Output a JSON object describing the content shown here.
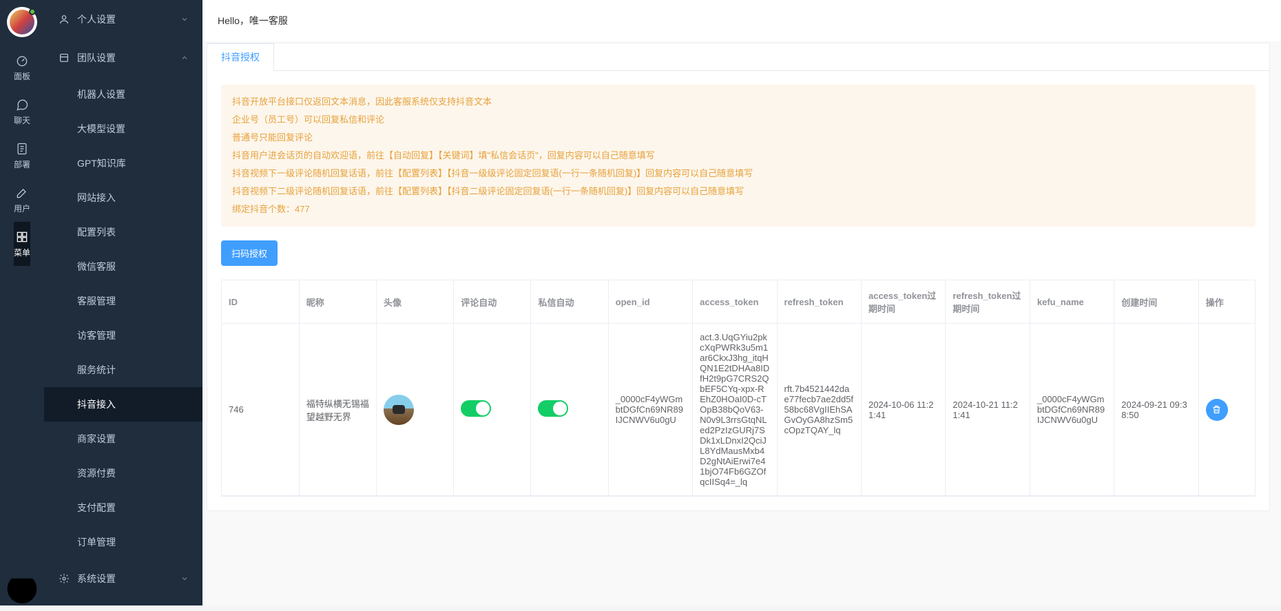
{
  "narrowNav": [
    {
      "label": "面板",
      "icon": "gauge"
    },
    {
      "label": "聊天",
      "icon": "chat"
    },
    {
      "label": "部署",
      "icon": "file"
    },
    {
      "label": "用户",
      "icon": "edit"
    },
    {
      "label": "菜单",
      "icon": "grid"
    }
  ],
  "narrowActive": 4,
  "wideMenu": {
    "personal": {
      "label": "个人设置"
    },
    "team": {
      "label": "团队设置"
    },
    "system": {
      "label": "系统设置"
    },
    "teamItems": [
      "机器人设置",
      "大模型设置",
      "GPT知识库",
      "网站接入",
      "配置列表",
      "微信客服",
      "客服管理",
      "访客管理",
      "服务统计",
      "抖音接入",
      "商家设置",
      "资源付费",
      "支付配置",
      "订单管理"
    ],
    "activeTeamItem": 9
  },
  "header": {
    "greeting": "Hello，唯一客服"
  },
  "tab": {
    "label": "抖音授权"
  },
  "alert": {
    "lines": [
      "抖音开放平台接口仅返回文本消息，因此客服系统仅支持抖音文本",
      "企业号（员工号）可以回复私信和评论",
      "普通号只能回复评论",
      "抖音用户进会话页的自动欢迎语，前往【自动回复】【关键词】填\"私信会话页\"，回复内容可以自己随意填写",
      "抖音视频下一级评论随机回复话语，前往【配置列表】【抖音一级级评论固定回复语(一行一条随机回复)】回复内容可以自己随意填写",
      "抖音视频下二级评论随机回复话语，前往【配置列表】【抖音二级评论固定回复语(一行一条随机回复)】回复内容可以自己随意填写",
      "绑定抖音个数：477"
    ]
  },
  "buttons": {
    "scanAuth": "扫码授权"
  },
  "table": {
    "headers": {
      "id": "ID",
      "nickname": "昵称",
      "avatar": "头像",
      "commentAuto": "评论自动",
      "privateAuto": "私信自动",
      "openId": "open_id",
      "accessToken": "access_token",
      "refreshToken": "refresh_token",
      "atExpire": "access_token过期时间",
      "rtExpire": "refresh_token过期时间",
      "kefuName": "kefu_name",
      "createTime": "创建时间",
      "action": "操作"
    },
    "row": {
      "id": "746",
      "nickname": "福特纵横无锡福望越野无界",
      "open_id": "_0000cF4yWGmbtDGfCn69NR89IJCNWV6u0gU",
      "access_token": "act.3.UqGYiu2pkcXqPWRk3u5m1ar6CkxJ3hg_itqHQN1E2tDHAa8IDfH2t9pG7CRS2QbEF5CYq-xpx-REhZ0HOaI0D-cTOpB38bQoV63-N0v9L3rrsGtqNLed2PzIzGURj7SDk1xLDnxI2QciJL8YdMausMxb4D2gNtAiErwi7e41bjO74Fb6GZOfqcIISq4=_lq",
      "refresh_token": "rft.7b4521442dae77fecb7ae2dd5f58bc68VgIIEhSAGvOyGA8hzSm5cOpzTQAY_lq",
      "at_expire": "2024-10-06 11:21:41",
      "rt_expire": "2024-10-21 11:21:41",
      "kefu_name": "_0000cF4yWGmbtDGfCn69NR89IJCNWV6u0gU",
      "create_time": "2024-09-21 09:38:50"
    }
  }
}
